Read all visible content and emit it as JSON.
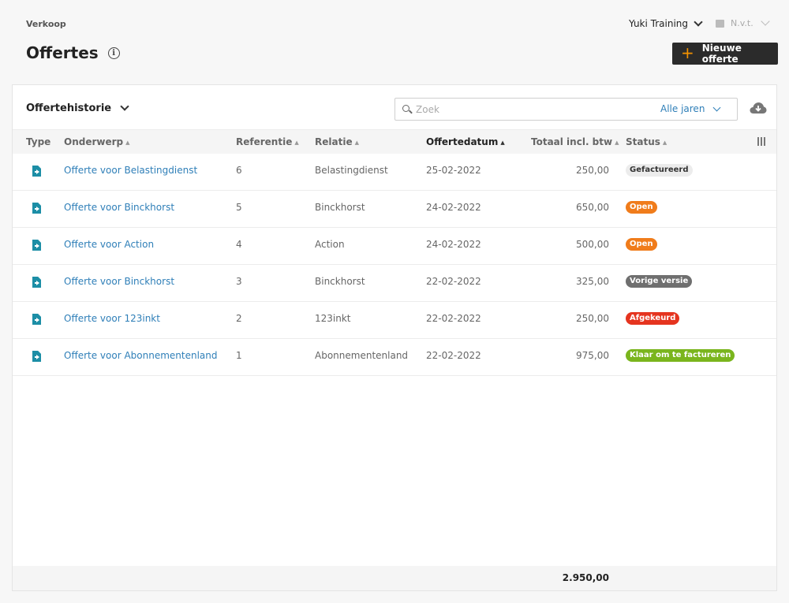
{
  "header": {
    "breadcrumb": "Verkoop",
    "title": "Offertes",
    "organization": "Yuki Training",
    "period": "N.v.t.",
    "new_button": "Nieuwe offerte"
  },
  "panel": {
    "view_selector": "Offertehistorie",
    "search_placeholder": "Zoek",
    "year_filter": "Alle jaren"
  },
  "columns": {
    "type": "Type",
    "onderwerp": "Onderwerp",
    "referentie": "Referentie",
    "relatie": "Relatie",
    "offertedatum": "Offertedatum",
    "totaal": "Totaal incl. btw",
    "status": "Status"
  },
  "rows": [
    {
      "onderwerp": "Offerte voor Belastingdienst",
      "referentie": "6",
      "relatie": "Belastingdienst",
      "datum": "25-02-2022",
      "totaal": "250,00",
      "status": "Gefactureerd",
      "status_color": "#ececec",
      "status_text_color": "#333333"
    },
    {
      "onderwerp": "Offerte voor Binckhorst",
      "referentie": "5",
      "relatie": "Binckhorst",
      "datum": "24-02-2022",
      "totaal": "650,00",
      "status": "Open",
      "status_color": "#f07c1b",
      "status_text_color": "#ffffff"
    },
    {
      "onderwerp": "Offerte voor Action",
      "referentie": "4",
      "relatie": "Action",
      "datum": "24-02-2022",
      "totaal": "500,00",
      "status": "Open",
      "status_color": "#f07c1b",
      "status_text_color": "#ffffff"
    },
    {
      "onderwerp": "Offerte voor Binckhorst",
      "referentie": "3",
      "relatie": "Binckhorst",
      "datum": "22-02-2022",
      "totaal": "325,00",
      "status": "Vorige versie",
      "status_color": "#6f6f6f",
      "status_text_color": "#ffffff"
    },
    {
      "onderwerp": "Offerte voor 123inkt",
      "referentie": "2",
      "relatie": "123inkt",
      "datum": "22-02-2022",
      "totaal": "250,00",
      "status": "Afgekeurd",
      "status_color": "#e5341f",
      "status_text_color": "#ffffff"
    },
    {
      "onderwerp": "Offerte voor Abonnementenland",
      "referentie": "1",
      "relatie": "Abonnementenland",
      "datum": "22-02-2022",
      "totaal": "975,00",
      "status": "Klaar om te factureren",
      "status_color": "#7ab51d",
      "status_text_color": "#ffffff"
    }
  ],
  "footer": {
    "total": "2.950,00"
  },
  "icons": {
    "info": "info-icon",
    "calendar": "calendar-icon",
    "search": "search-icon",
    "download": "cloud-download-icon",
    "columns": "columns-icon",
    "document": "quote-document-icon"
  },
  "colors": {
    "link": "#2f7fb8",
    "accent": "#f39200",
    "primary_button": "#2b2b2b"
  }
}
